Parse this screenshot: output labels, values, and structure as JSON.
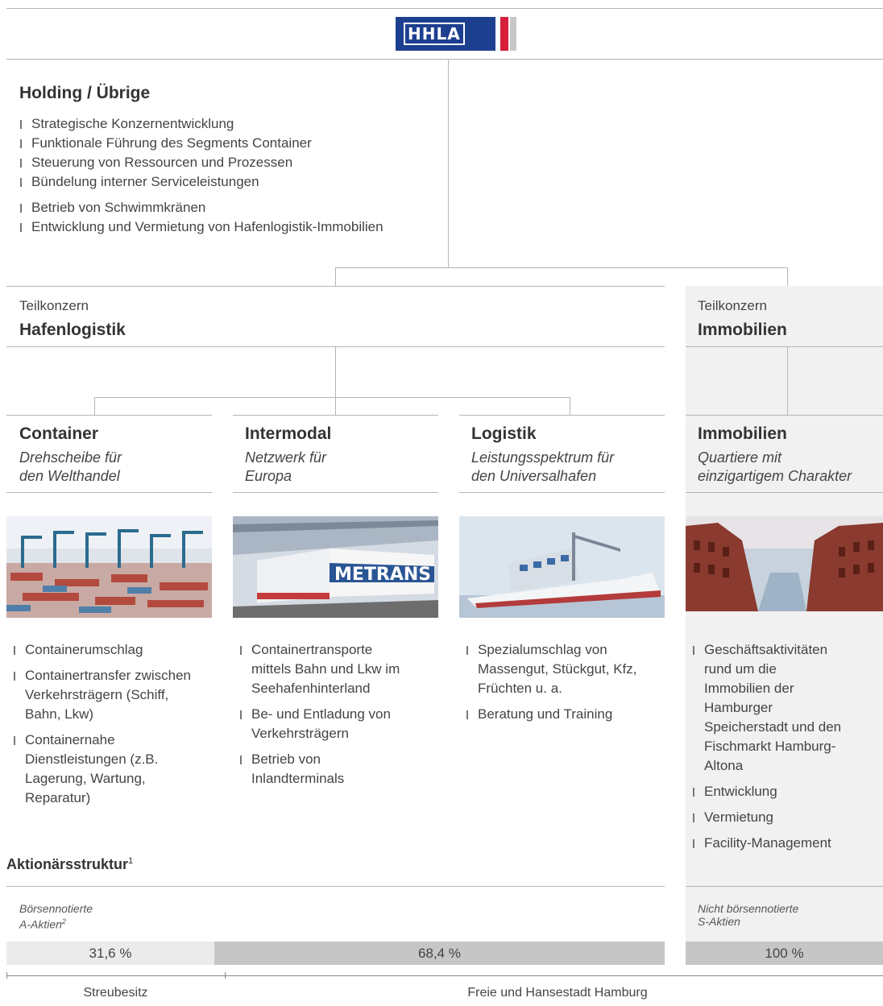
{
  "logo": {
    "text": "HHLA"
  },
  "holding": {
    "title": "Holding / Übrige",
    "items": [
      "Strategische Konzernentwicklung",
      "Funktionale Führung des Segments Container",
      "Steuerung von Ressourcen und Prozessen",
      "Bündelung interner Serviceleistungen",
      "Betrieb von Schwimmkränen",
      "Entwicklung und Vermietung von Hafenlogistik-Immobilien"
    ]
  },
  "subgroups": [
    {
      "prefix": "Teilkonzern",
      "name": "Hafenlogistik"
    },
    {
      "prefix": "Teilkonzern",
      "name": "Immobilien"
    }
  ],
  "segments": [
    {
      "title": "Container",
      "subtitle_line1": "Drehscheibe für",
      "subtitle_line2": "den Welthandel",
      "items": [
        "Containerumschlag",
        "Containertransfer zwischen Verkehrsträgern (Schiff, Bahn, Lkw)",
        "Containernahe Dienstleistungen (z.B. Lagerung, Wartung, Reparatur)"
      ]
    },
    {
      "title": "Intermodal",
      "subtitle_line1": "Netzwerk für",
      "subtitle_line2": "Europa",
      "items": [
        "Containertransporte mittels Bahn und Lkw im Seehafenhinterland",
        "Be- und Entladung von Verkehrsträgern",
        "Betrieb von Inlandterminals"
      ]
    },
    {
      "title": "Logistik",
      "subtitle_line1": "Leistungsspektrum für",
      "subtitle_line2": "den Universalhafen",
      "items": [
        "Spezialumschlag von Massengut, Stückgut, Kfz, Früchten u. a.",
        "Beratung und Training"
      ]
    },
    {
      "title": "Immobilien",
      "subtitle_line1": "Quartiere mit",
      "subtitle_line2": "einzigartigem Charakter",
      "items": [
        "Geschäftsaktivitäten rund um die Immobilien der Hamburger Speicherstadt und den Fischmarkt Hamburg-Altona",
        "Entwicklung",
        "Vermietung",
        "Facility-Management"
      ]
    }
  ],
  "photo_labels": {
    "intermodal": "METRANS"
  },
  "shareholders": {
    "title": "Aktionärsstruktur",
    "title_sup": "1",
    "a_label_line1": "Börsennotierte",
    "a_label_line2": "A-Aktien",
    "a_sup": "2",
    "s_label_line1": "Nicht börsennotierte",
    "s_label_line2": "S-Aktien",
    "bars": [
      {
        "value": "31,6 %",
        "fraction": 0.316,
        "color": "#ebebeb"
      },
      {
        "value": "68,4 %",
        "fraction": 0.684,
        "color": "#c6c6c6"
      },
      {
        "value": "100 %",
        "fraction": 1.0,
        "color": "#c6c6c6"
      }
    ],
    "owner_free": "Streubesitz",
    "owner_city": "Freie und Hansestadt Hamburg"
  }
}
